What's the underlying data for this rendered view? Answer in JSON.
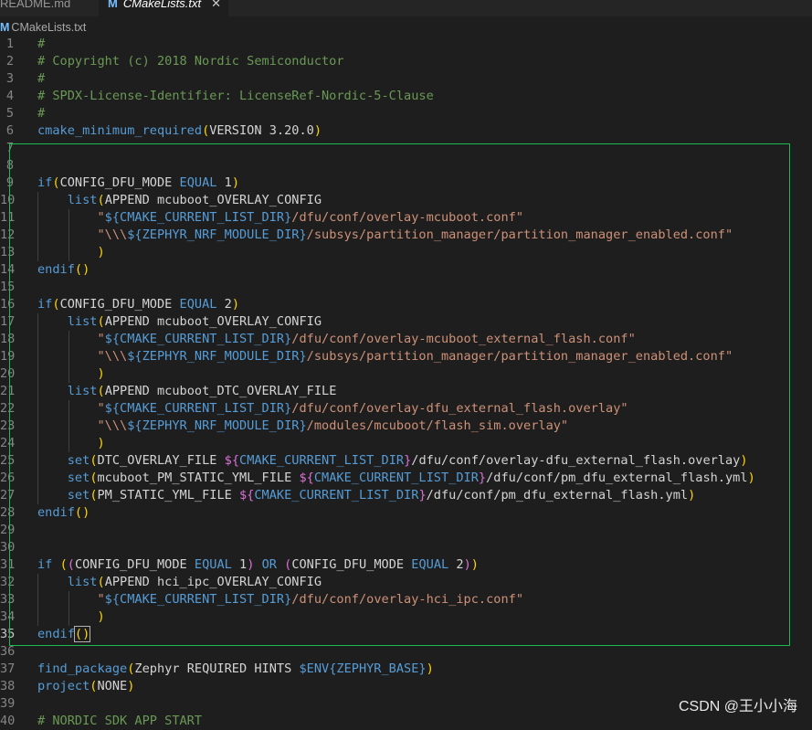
{
  "tabs": [
    {
      "label": "README.md",
      "active": false
    },
    {
      "label": "CMakeLists.txt",
      "active": true,
      "icon": "M"
    }
  ],
  "breadcrumb": {
    "icon": "M",
    "label": "CMakeLists.txt"
  },
  "editor": {
    "active_line": 35,
    "lines": [
      {
        "n": "1",
        "tokens": [
          [
            "#",
            "comment"
          ]
        ]
      },
      {
        "n": "2",
        "tokens": [
          [
            "# Copyright (c) 2018 Nordic Semiconductor",
            "comment"
          ]
        ]
      },
      {
        "n": "3",
        "tokens": [
          [
            "#",
            "comment"
          ]
        ]
      },
      {
        "n": "4",
        "tokens": [
          [
            "# SPDX-License-Identifier: LicenseRef-Nordic-5-Clause",
            "comment"
          ]
        ]
      },
      {
        "n": "5",
        "tokens": [
          [
            "#",
            "comment"
          ]
        ]
      },
      {
        "n": "6",
        "tokens": [
          [
            "cmake_minimum_required",
            "cmd"
          ],
          [
            "(",
            "p1"
          ],
          [
            "VERSION 3.20.0",
            "d"
          ],
          [
            ")",
            "p1"
          ]
        ]
      },
      {
        "n": "7",
        "tokens": []
      },
      {
        "n": "8",
        "tokens": []
      },
      {
        "n": "9",
        "tokens": [
          [
            "if",
            "cmd"
          ],
          [
            "(",
            "p1"
          ],
          [
            "CONFIG_DFU_MODE ",
            "d"
          ],
          [
            "EQUAL",
            "cmd"
          ],
          [
            " 1",
            "d"
          ],
          [
            ")",
            "p1"
          ]
        ]
      },
      {
        "n": "10",
        "indent": 1,
        "tokens": [
          [
            "    ",
            "d"
          ],
          [
            "list",
            "cmd"
          ],
          [
            "(",
            "p1"
          ],
          [
            "APPEND mcuboot_OVERLAY_CONFIG",
            "d"
          ]
        ]
      },
      {
        "n": "11",
        "indent": 2,
        "tokens": [
          [
            "        ",
            "d"
          ],
          [
            "\"",
            "str"
          ],
          [
            "${",
            "var"
          ],
          [
            "CMAKE_CURRENT_LIST_DIR",
            "var"
          ],
          [
            "}",
            "var"
          ],
          [
            "/dfu/conf/overlay-mcuboot.conf\"",
            "str"
          ]
        ]
      },
      {
        "n": "12",
        "indent": 2,
        "tokens": [
          [
            "        ",
            "d"
          ],
          [
            "\"\\\\\\",
            "str"
          ],
          [
            "${",
            "var"
          ],
          [
            "ZEPHYR_NRF_MODULE_DIR",
            "var"
          ],
          [
            "}",
            "var"
          ],
          [
            "/subsys/partition_manager/partition_manager_enabled.conf\"",
            "str"
          ]
        ]
      },
      {
        "n": "13",
        "indent": 2,
        "tokens": [
          [
            "        ",
            "d"
          ],
          [
            ")",
            "p1"
          ]
        ]
      },
      {
        "n": "14",
        "tokens": [
          [
            "endif",
            "cmd"
          ],
          [
            "()",
            "p1"
          ]
        ]
      },
      {
        "n": "15",
        "tokens": []
      },
      {
        "n": "16",
        "tokens": [
          [
            "if",
            "cmd"
          ],
          [
            "(",
            "p1"
          ],
          [
            "CONFIG_DFU_MODE ",
            "d"
          ],
          [
            "EQUAL",
            "cmd"
          ],
          [
            " 2",
            "d"
          ],
          [
            ")",
            "p1"
          ]
        ]
      },
      {
        "n": "17",
        "indent": 1,
        "tokens": [
          [
            "    ",
            "d"
          ],
          [
            "list",
            "cmd"
          ],
          [
            "(",
            "p1"
          ],
          [
            "APPEND mcuboot_OVERLAY_CONFIG",
            "d"
          ]
        ]
      },
      {
        "n": "18",
        "indent": 2,
        "tokens": [
          [
            "        ",
            "d"
          ],
          [
            "\"",
            "str"
          ],
          [
            "${",
            "var"
          ],
          [
            "CMAKE_CURRENT_LIST_DIR",
            "var"
          ],
          [
            "}",
            "var"
          ],
          [
            "/dfu/conf/overlay-mcuboot_external_flash.conf\"",
            "str"
          ]
        ]
      },
      {
        "n": "19",
        "indent": 2,
        "tokens": [
          [
            "        ",
            "d"
          ],
          [
            "\"\\\\\\",
            "str"
          ],
          [
            "${",
            "var"
          ],
          [
            "ZEPHYR_NRF_MODULE_DIR",
            "var"
          ],
          [
            "}",
            "var"
          ],
          [
            "/subsys/partition_manager/partition_manager_enabled.conf\"",
            "str"
          ]
        ]
      },
      {
        "n": "20",
        "indent": 2,
        "tokens": [
          [
            "        ",
            "d"
          ],
          [
            ")",
            "p1"
          ]
        ]
      },
      {
        "n": "21",
        "indent": 1,
        "tokens": [
          [
            "    ",
            "d"
          ],
          [
            "list",
            "cmd"
          ],
          [
            "(",
            "p1"
          ],
          [
            "APPEND mcuboot_DTC_OVERLAY_FILE",
            "d"
          ]
        ]
      },
      {
        "n": "22",
        "indent": 2,
        "tokens": [
          [
            "        ",
            "d"
          ],
          [
            "\"",
            "str"
          ],
          [
            "${",
            "var"
          ],
          [
            "CMAKE_CURRENT_LIST_DIR",
            "var"
          ],
          [
            "}",
            "var"
          ],
          [
            "/dfu/conf/overlay-dfu_external_flash.overlay\"",
            "str"
          ]
        ]
      },
      {
        "n": "23",
        "indent": 2,
        "tokens": [
          [
            "        ",
            "d"
          ],
          [
            "\"\\\\\\",
            "str"
          ],
          [
            "${",
            "var"
          ],
          [
            "ZEPHYR_NRF_MODULE_DIR",
            "var"
          ],
          [
            "}",
            "var"
          ],
          [
            "/modules/mcuboot/flash_sim.overlay\"",
            "str"
          ]
        ]
      },
      {
        "n": "24",
        "indent": 2,
        "tokens": [
          [
            "        ",
            "d"
          ],
          [
            ")",
            "p1"
          ]
        ]
      },
      {
        "n": "25",
        "indent": 1,
        "tokens": [
          [
            "    ",
            "d"
          ],
          [
            "set",
            "cmd"
          ],
          [
            "(",
            "p1"
          ],
          [
            "DTC_OVERLAY_FILE ",
            "d"
          ],
          [
            "${",
            "p2"
          ],
          [
            "CMAKE_CURRENT_LIST_DIR",
            "var"
          ],
          [
            "}",
            "p2"
          ],
          [
            "/dfu/conf/overlay-dfu_external_flash.overlay",
            "d"
          ],
          [
            ")",
            "p1"
          ]
        ]
      },
      {
        "n": "26",
        "indent": 1,
        "tokens": [
          [
            "    ",
            "d"
          ],
          [
            "set",
            "cmd"
          ],
          [
            "(",
            "p1"
          ],
          [
            "mcuboot_PM_STATIC_YML_FILE ",
            "d"
          ],
          [
            "${",
            "p2"
          ],
          [
            "CMAKE_CURRENT_LIST_DIR",
            "var"
          ],
          [
            "}",
            "p2"
          ],
          [
            "/dfu/conf/pm_dfu_external_flash.yml",
            "d"
          ],
          [
            ")",
            "p1"
          ]
        ]
      },
      {
        "n": "27",
        "indent": 1,
        "tokens": [
          [
            "    ",
            "d"
          ],
          [
            "set",
            "cmd"
          ],
          [
            "(",
            "p1"
          ],
          [
            "PM_STATIC_YML_FILE ",
            "d"
          ],
          [
            "${",
            "p2"
          ],
          [
            "CMAKE_CURRENT_LIST_DIR",
            "var"
          ],
          [
            "}",
            "p2"
          ],
          [
            "/dfu/conf/pm_dfu_external_flash.yml",
            "d"
          ],
          [
            ")",
            "p1"
          ]
        ]
      },
      {
        "n": "28",
        "tokens": [
          [
            "endif",
            "cmd"
          ],
          [
            "()",
            "p1"
          ]
        ]
      },
      {
        "n": "29",
        "tokens": []
      },
      {
        "n": "30",
        "tokens": []
      },
      {
        "n": "31",
        "tokens": [
          [
            "if",
            "cmd"
          ],
          [
            " ",
            "d"
          ],
          [
            "(",
            "p1"
          ],
          [
            "(",
            "p2"
          ],
          [
            "CONFIG_DFU_MODE ",
            "d"
          ],
          [
            "EQUAL",
            "cmd"
          ],
          [
            " 1",
            "d"
          ],
          [
            ")",
            "p2"
          ],
          [
            " ",
            "d"
          ],
          [
            "OR",
            "cmd"
          ],
          [
            " ",
            "d"
          ],
          [
            "(",
            "p2"
          ],
          [
            "CONFIG_DFU_MODE ",
            "d"
          ],
          [
            "EQUAL",
            "cmd"
          ],
          [
            " 2",
            "d"
          ],
          [
            ")",
            "p2"
          ],
          [
            ")",
            "p1"
          ]
        ]
      },
      {
        "n": "32",
        "indent": 1,
        "tokens": [
          [
            "    ",
            "d"
          ],
          [
            "list",
            "cmd"
          ],
          [
            "(",
            "p1"
          ],
          [
            "APPEND hci_ipc_OVERLAY_CONFIG",
            "d"
          ]
        ]
      },
      {
        "n": "33",
        "indent": 2,
        "tokens": [
          [
            "        ",
            "d"
          ],
          [
            "\"",
            "str"
          ],
          [
            "${",
            "var"
          ],
          [
            "CMAKE_CURRENT_LIST_DIR",
            "var"
          ],
          [
            "}",
            "var"
          ],
          [
            "/dfu/conf/overlay-hci_ipc.conf\"",
            "str"
          ]
        ]
      },
      {
        "n": "34",
        "indent": 2,
        "tokens": [
          [
            "        ",
            "d"
          ],
          [
            ")",
            "p1"
          ]
        ]
      },
      {
        "n": "35",
        "tokens": [
          [
            "endif",
            "cmd"
          ],
          [
            "()",
            "p1cursor"
          ]
        ]
      },
      {
        "n": "36",
        "tokens": []
      },
      {
        "n": "37",
        "tokens": [
          [
            "find_package",
            "cmd"
          ],
          [
            "(",
            "p1"
          ],
          [
            "Zephyr REQUIRED HINTS ",
            "d"
          ],
          [
            "$ENV{",
            "cmd"
          ],
          [
            "ZEPHYR_BASE",
            "var"
          ],
          [
            "}",
            "cmd"
          ],
          [
            ")",
            "p1"
          ]
        ]
      },
      {
        "n": "38",
        "tokens": [
          [
            "project",
            "cmd"
          ],
          [
            "(",
            "p1"
          ],
          [
            "NONE",
            "d"
          ],
          [
            ")",
            "p1"
          ]
        ]
      },
      {
        "n": "39",
        "tokens": []
      },
      {
        "n": "40",
        "tokens": [
          [
            "# NORDIC SDK APP START",
            "comment"
          ]
        ]
      }
    ]
  },
  "watermark": "CSDN @王小小海",
  "colors": {
    "highlight_box": "#1db954",
    "background": "#1e1e1e"
  }
}
